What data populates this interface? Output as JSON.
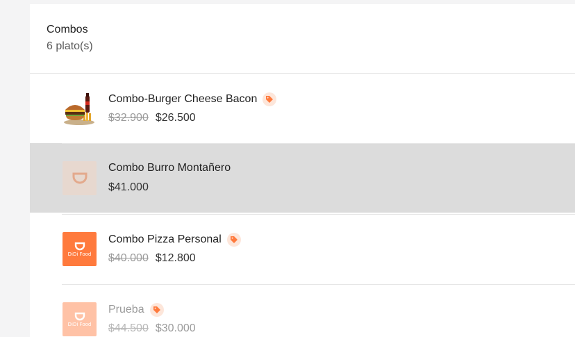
{
  "category": {
    "title": "Combos",
    "count": "6 plato(s)"
  },
  "brand": {
    "accent": "#ff7a3d",
    "logo_text": "DiDi Food"
  },
  "items": [
    {
      "name": "Combo-Burger Cheese Bacon",
      "old_price": "$32.900",
      "price": "$26.500",
      "has_discount_tag": true,
      "thumb": "burger-combo-photo",
      "selected": false,
      "disabled": false
    },
    {
      "name": "Combo Burro Montañero",
      "old_price": "",
      "price": "$41.000",
      "has_discount_tag": false,
      "thumb": "placeholder-logo-faded",
      "selected": true,
      "disabled": false
    },
    {
      "name": "Combo Pizza Personal",
      "old_price": "$40.000",
      "price": "$12.800",
      "has_discount_tag": true,
      "thumb": "didi-food-logo",
      "selected": false,
      "disabled": false
    },
    {
      "name": "Prueba",
      "old_price": "$44.500",
      "price": "$30.000",
      "has_discount_tag": true,
      "thumb": "didi-food-logo-faded",
      "selected": false,
      "disabled": true
    }
  ]
}
